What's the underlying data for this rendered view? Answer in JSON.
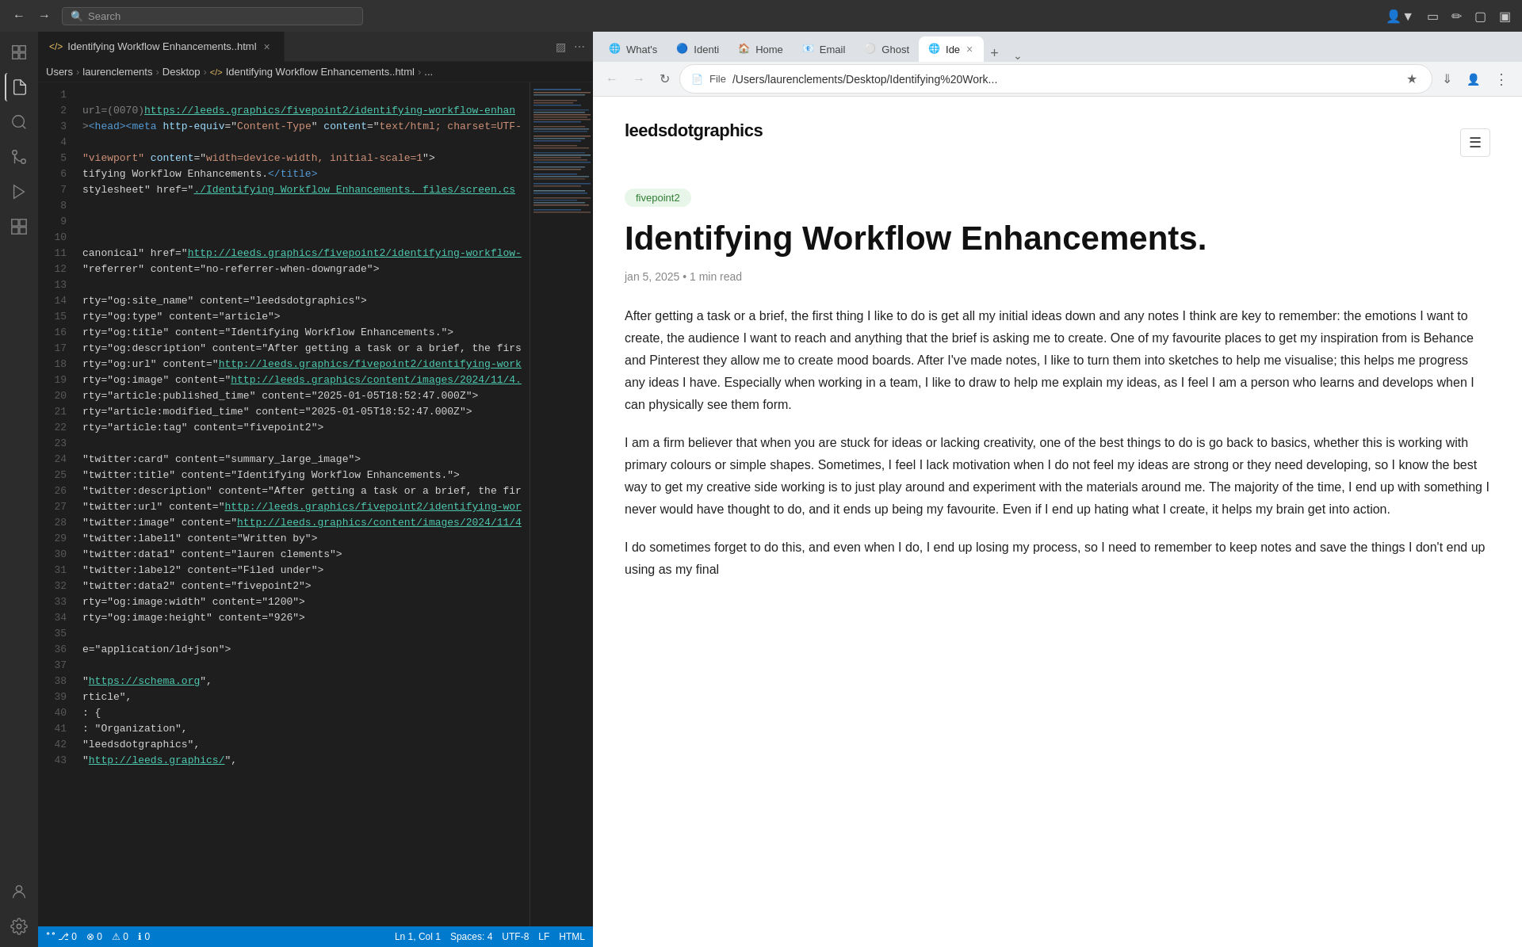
{
  "topbar": {
    "search_placeholder": "Search",
    "nav_back_label": "←",
    "nav_forward_label": "→"
  },
  "editor": {
    "tab_title": "Identifying Workflow Enhancements..html",
    "breadcrumb": {
      "users": "Users",
      "username": "laurenclements",
      "folder": "Desktop",
      "file_label": "</> Identifying Workflow Enhancements..html",
      "ellipsis": "..."
    },
    "lines": [
      {
        "n": 1,
        "code": ""
      },
      {
        "n": 2,
        "code": "  url=(0070)https://leeds.graphics/fivepoint2/identifying-workflow-enhan"
      },
      {
        "n": 3,
        "code": "  ><head><meta http-equiv=\"Content-Type\" content=\"text/html; charset=UTF-"
      },
      {
        "n": 4,
        "code": ""
      },
      {
        "n": 5,
        "code": "  \"viewport\" content=\"width=device-width, initial-scale=1\">"
      },
      {
        "n": 6,
        "code": "  tifying Workflow Enhancements.</title>"
      },
      {
        "n": 7,
        "code": "  stylesheet\" href=\"./Identifying Workflow Enhancements._files/screen.cs"
      },
      {
        "n": 8,
        "code": ""
      },
      {
        "n": 9,
        "code": ""
      },
      {
        "n": 10,
        "code": ""
      },
      {
        "n": 11,
        "code": "  canonical\" href=\"http://leeds.graphics/fivepoint2/identifying-workflow-"
      },
      {
        "n": 12,
        "code": "  \"referrer\" content=\"no-referrer-when-downgrade\">"
      },
      {
        "n": 13,
        "code": ""
      },
      {
        "n": 14,
        "code": "  rty=\"og:site_name\" content=\"leedsdotgraphics\">"
      },
      {
        "n": 15,
        "code": "  rty=\"og:type\" content=\"article\">"
      },
      {
        "n": 16,
        "code": "  rty=\"og:title\" content=\"Identifying Workflow Enhancements.\">"
      },
      {
        "n": 17,
        "code": "  rty=\"og:description\" content=\"After getting a task or a brief, the firs"
      },
      {
        "n": 18,
        "code": "  rty=\"og:url\" content=\"http://leeds.graphics/fivepoint2/identifying-work"
      },
      {
        "n": 19,
        "code": "  rty=\"og:image\" content=\"http://leeds.graphics/content/images/2024/11/4."
      },
      {
        "n": 20,
        "code": "  rty=\"article:published_time\" content=\"2025-01-05T18:52:47.000Z\">"
      },
      {
        "n": 21,
        "code": "  rty=\"article:modified_time\" content=\"2025-01-05T18:52:47.000Z\">"
      },
      {
        "n": 22,
        "code": "  rty=\"article:tag\" content=\"fivepoint2\">"
      },
      {
        "n": 23,
        "code": ""
      },
      {
        "n": 24,
        "code": "  \"twitter:card\" content=\"summary_large_image\">"
      },
      {
        "n": 25,
        "code": "  \"twitter:title\" content=\"Identifying Workflow Enhancements.\">"
      },
      {
        "n": 26,
        "code": "  \"twitter:description\" content=\"After getting a task or a brief, the fir"
      },
      {
        "n": 27,
        "code": "  \"twitter:url\" content=\"http://leeds.graphics/fivepoint2/identifying-wor"
      },
      {
        "n": 28,
        "code": "  \"twitter:image\" content=\"http://leeds.graphics/content/images/2024/11/4"
      },
      {
        "n": 29,
        "code": "  \"twitter:label1\" content=\"Written by\">"
      },
      {
        "n": 30,
        "code": "  \"twitter:data1\" content=\"lauren clements\">"
      },
      {
        "n": 31,
        "code": "  \"twitter:label2\" content=\"Filed under\">"
      },
      {
        "n": 32,
        "code": "  \"twitter:data2\" content=\"fivepoint2\">"
      },
      {
        "n": 33,
        "code": "  rty=\"og:image:width\" content=\"1200\">"
      },
      {
        "n": 34,
        "code": "  rty=\"og:image:height\" content=\"926\">"
      },
      {
        "n": 35,
        "code": ""
      },
      {
        "n": 36,
        "code": "  e=\"application/ld+json\">"
      },
      {
        "n": 37,
        "code": ""
      },
      {
        "n": 38,
        "code": "    \"https://schema.org\","
      },
      {
        "n": 39,
        "code": "    rticle\","
      },
      {
        "n": 40,
        "code": "    : {"
      },
      {
        "n": 41,
        "code": "    : \"Organization\","
      },
      {
        "n": 42,
        "code": "    \"leedsdotgraphics\","
      },
      {
        "n": 43,
        "code": "    \"http://leeds.graphics/\","
      }
    ],
    "status": {
      "errors": "⊗ 0",
      "warnings": "⚠ 0",
      "info": "ℹ 0",
      "git_branch": "⎇ 0",
      "line_col": "Ln 1, Col 1",
      "spaces": "Spaces: 4",
      "encoding": "UTF-8",
      "eol": "LF",
      "language": "HTML"
    }
  },
  "browser": {
    "tabs": [
      {
        "id": "whats",
        "label": "What's",
        "favicon": "🌐",
        "active": false
      },
      {
        "id": "identi",
        "label": "Identi",
        "favicon": "🔵",
        "active": false
      },
      {
        "id": "home",
        "label": "Home",
        "favicon": "🏠",
        "active": false
      },
      {
        "id": "email",
        "label": "Email",
        "favicon": "📧",
        "active": false
      },
      {
        "id": "ghost",
        "label": "Ghost",
        "favicon": "⚪",
        "active": false
      },
      {
        "id": "ide",
        "label": "Ide",
        "favicon": "🌐",
        "active": true
      }
    ],
    "address": "/Users/laurenclements/Desktop/Identifying%20Work...",
    "address_full": "/Users/laurenclements/Desktop/Identifying%20Work...",
    "protocol": "File"
  },
  "webpage": {
    "site_name": "leedsdotgraphics",
    "category": "fivepoint2",
    "title": "Identifying Workflow Enhancements.",
    "meta": "jan 5, 2025  •  1 min read",
    "body": [
      "After getting a task or a brief, the first thing I like to do is get all my initial ideas down and any notes I think are key to remember: the emotions I want to create, the audience I want to reach and anything that the brief is asking me to create. One of my favourite places to get my inspiration from is Behance and Pinterest they allow me to create mood boards. After I've made notes, I like to turn them into sketches to help me visualise; this helps me progress any ideas I have. Especially when working in a team, I like to draw to help me explain my ideas, as I feel I am a person who learns and develops when I can physically see them form.",
      "I am a firm believer that when you are stuck for ideas or lacking creativity, one of the best things to do is go back to basics, whether this is working with primary colours or simple shapes. Sometimes, I feel I lack motivation when I do not feel my ideas are strong or they need developing, so I know the best way to get my creative side working is to just play around and experiment with the materials around me. The majority of the time, I end up with something I never would have thought to do, and it ends up being my favourite. Even if I end up hating what I create, it helps my brain get into action.",
      "I do sometimes forget to do this, and even when I do, I end up losing my process, so I need to remember to keep notes and save the things I don't end up using as my final"
    ]
  }
}
